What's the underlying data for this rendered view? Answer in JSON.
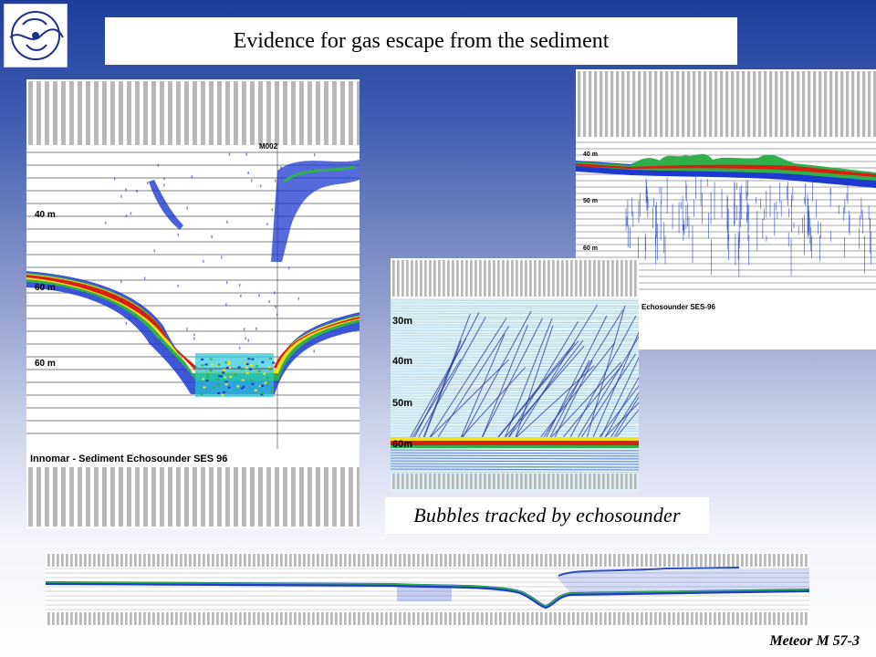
{
  "slide": {
    "title": "Evidence for gas escape from the sediment",
    "caption": "Bubbles tracked by echosounder",
    "footer": "Meteor M 57-3"
  },
  "echogram_main": {
    "marker": "M002",
    "depth_labels": [
      "40 m",
      "60 m",
      "60 m"
    ],
    "instrument": "Innomar - Sediment Echosounder SES 96"
  },
  "echogram_right": {
    "depth_labels": [
      "40 m",
      "50 m",
      "60 m"
    ],
    "instrument": "Echosounder SES-96"
  },
  "echogram_bubbles": {
    "depth_labels": [
      "30m",
      "40m",
      "50m",
      "60m"
    ]
  },
  "colors": {
    "background_top": "#1f3f9a",
    "background_bottom": "#ffffff",
    "echo_blue": "#1c3ad0",
    "echo_red": "#d81f10",
    "echo_yellow": "#f0e020",
    "echo_green": "#2fb04a"
  }
}
